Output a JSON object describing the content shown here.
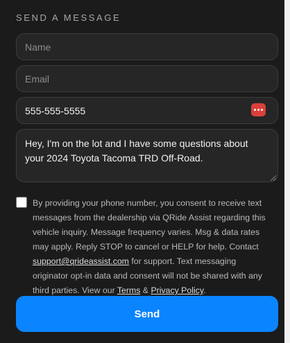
{
  "form": {
    "heading": "SEND A MESSAGE",
    "name": {
      "placeholder": "Name",
      "value": ""
    },
    "email": {
      "placeholder": "Email",
      "value": ""
    },
    "phone": {
      "value": "555-555-5555"
    },
    "message": {
      "value": "Hey, I'm on the lot and I have some questions about your 2024 Toyota Tacoma TRD Off-Road."
    },
    "consent": {
      "checked": false,
      "text_1": "By providing your phone number, you consent to receive text messages from the dealership via QRide Assist regarding this vehicle inquiry. Message frequency varies. Msg & data rates may apply. Reply STOP to cancel or HELP for help. Contact ",
      "support_link": "support@qrideassist.com",
      "text_2": " for support. Text messaging originator opt-in data and consent will not be shared with any third parties. View our ",
      "terms_link": "Terms",
      "text_3": " & ",
      "privacy_link": "Privacy Policy",
      "text_4": "."
    },
    "send_label": "Send"
  },
  "colors": {
    "background": "#1b1b1b",
    "field_background": "#262626",
    "accent": "#0a84ff",
    "icon_red": "#d9413a"
  },
  "icons": {
    "phone_field_button": "ellipsis-icon"
  }
}
